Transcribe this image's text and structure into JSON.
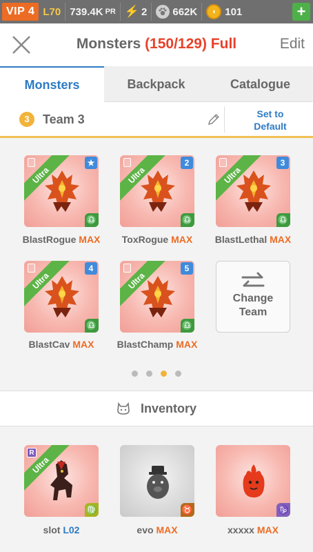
{
  "status_bar": {
    "vip": "VIP 4",
    "level": "L70",
    "power": "739.4K",
    "power_unit": "PR",
    "energy": "2",
    "food": "662K",
    "coins": "101",
    "add_label": "+"
  },
  "header": {
    "title": "Monsters",
    "count": "(150/129) Full",
    "edit": "Edit"
  },
  "tabs": [
    {
      "label": "Monsters",
      "active": true
    },
    {
      "label": "Backpack",
      "active": false
    },
    {
      "label": "Catalogue",
      "active": false
    }
  ],
  "team": {
    "number": "3",
    "name": "Team 3",
    "set_default_line1": "Set to",
    "set_default_line2": "Default"
  },
  "team_monsters": [
    {
      "name": "BlastRogue",
      "suffix": "MAX",
      "rarity": "Ultra",
      "slot": "★"
    },
    {
      "name": "ToxRogue",
      "suffix": "MAX",
      "rarity": "Ultra",
      "slot": "2"
    },
    {
      "name": "BlastLethal",
      "suffix": "MAX",
      "rarity": "Ultra",
      "slot": "3"
    },
    {
      "name": "BlastCav",
      "suffix": "MAX",
      "rarity": "Ultra",
      "slot": "4"
    },
    {
      "name": "BlastChamp",
      "suffix": "MAX",
      "rarity": "Ultra",
      "slot": "5"
    }
  ],
  "change_team": {
    "line1": "Change",
    "line2": "Team"
  },
  "pagination": {
    "pages": 4,
    "current": 3
  },
  "inventory": {
    "label": "Inventory",
    "items": [
      {
        "name": "slot",
        "suffix": "L02",
        "rarity": "Ultra",
        "rare_badge": "R",
        "zodiac": "♍"
      },
      {
        "name": "evo",
        "suffix": "MAX",
        "zodiac": "♉"
      },
      {
        "name": "xxxxx",
        "suffix": "MAX",
        "zodiac": "♑"
      }
    ]
  },
  "colors": {
    "accent_blue": "#2e7bc4",
    "max_orange": "#ec6c24",
    "full_red": "#e8412a",
    "ultra_green": "#5cb346",
    "team_yellow": "#f2b33a"
  }
}
